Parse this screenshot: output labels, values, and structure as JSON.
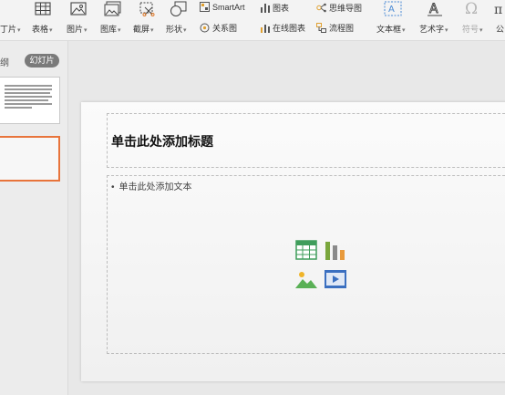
{
  "ribbon": {
    "top_items": {
      "smartart": "SmartArt",
      "chart": "图表",
      "mindmap": "思维导图"
    },
    "bottom_items": {
      "picture_cut": "丁片",
      "table": "表格",
      "picture": "图片",
      "gallery": "图库",
      "screenshot": "截屏",
      "shape": "形状",
      "relation": "关系图",
      "online_chart": "在线图表",
      "flowchart": "流程图",
      "textbox": "文本框",
      "wordart": "艺术字",
      "symbol": "符号",
      "formula_cut": "公"
    }
  },
  "left_pane": {
    "tab_outline": "纲",
    "tab_slides": "幻灯片"
  },
  "slide": {
    "title_placeholder": "单击此处添加标题",
    "body_placeholder": "单击此处添加文本",
    "bullet": "•"
  },
  "colors": {
    "accent_selection": "#e8743b",
    "icon_table": "#3f9d5b",
    "icon_chart": "#7aa63c",
    "icon_picture": "#5ab056",
    "icon_video": "#3a6fc0"
  }
}
